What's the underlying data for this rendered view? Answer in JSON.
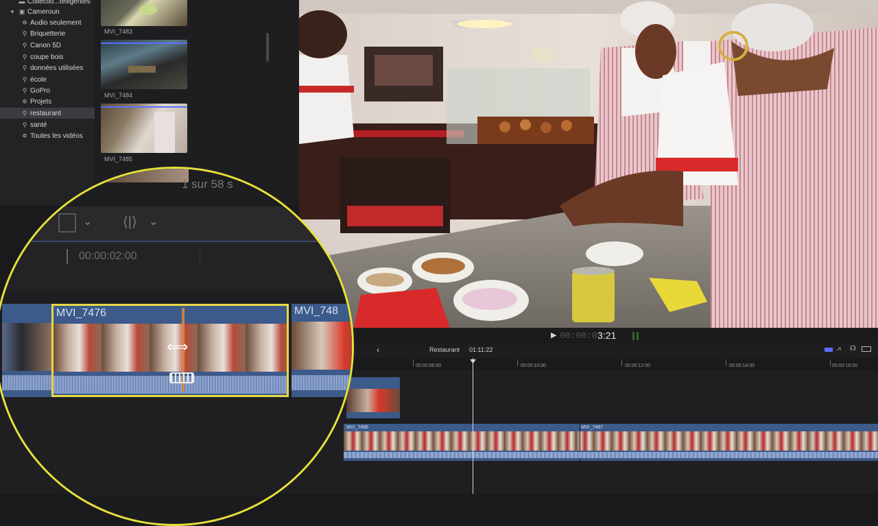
{
  "sidebar": {
    "items": [
      {
        "label": "Collectio...telligentes",
        "icon": "folder-icon"
      },
      {
        "label": "Cameroun",
        "icon": "library-icon"
      },
      {
        "label": "Audio seulement",
        "icon": "gear-icon"
      },
      {
        "label": "Briquetterie",
        "icon": "keyword-icon"
      },
      {
        "label": "Canon 5D",
        "icon": "keyword-icon"
      },
      {
        "label": "coupe bois",
        "icon": "keyword-icon"
      },
      {
        "label": "données utilisées",
        "icon": "keyword-icon"
      },
      {
        "label": "école",
        "icon": "keyword-icon"
      },
      {
        "label": "GoPro",
        "icon": "keyword-icon"
      },
      {
        "label": "Projets",
        "icon": "gear-icon"
      },
      {
        "label": "restaurant",
        "icon": "keyword-icon"
      },
      {
        "label": "santé",
        "icon": "keyword-icon"
      },
      {
        "label": "Toutes les vidéos",
        "icon": "gear-icon"
      }
    ],
    "selected": "restaurant"
  },
  "browser": {
    "clips": [
      {
        "label": "MVI_7483"
      },
      {
        "label": "MVI_7484"
      },
      {
        "label": "MVI_7485"
      }
    ],
    "count_text": "1 sur 58 s"
  },
  "viewer": {
    "timecode_dim": "00:00:0",
    "timecode_bright": "3:21",
    "play_icon": "play-icon"
  },
  "timeline": {
    "back_icon": "back-arrow-icon",
    "project_name": "Restaurant",
    "duration": "01:11:22",
    "ruler": [
      "00:00:08:00",
      "00:00:10:00",
      "00:00:12:00",
      "00:00:14:00",
      "00:00:16:00"
    ],
    "clips": [
      {
        "label": "MVI_7496"
      },
      {
        "label": "MVI_7497"
      }
    ],
    "accent": "#5a70ff"
  },
  "lens": {
    "timecode": "00:00:02:00",
    "clip_label": "MVI_7476",
    "next_clip_label": "MVI_748",
    "count_text": "1 sur 58 s",
    "border_color": "#e6e23a",
    "select_color": "#e8d848"
  }
}
